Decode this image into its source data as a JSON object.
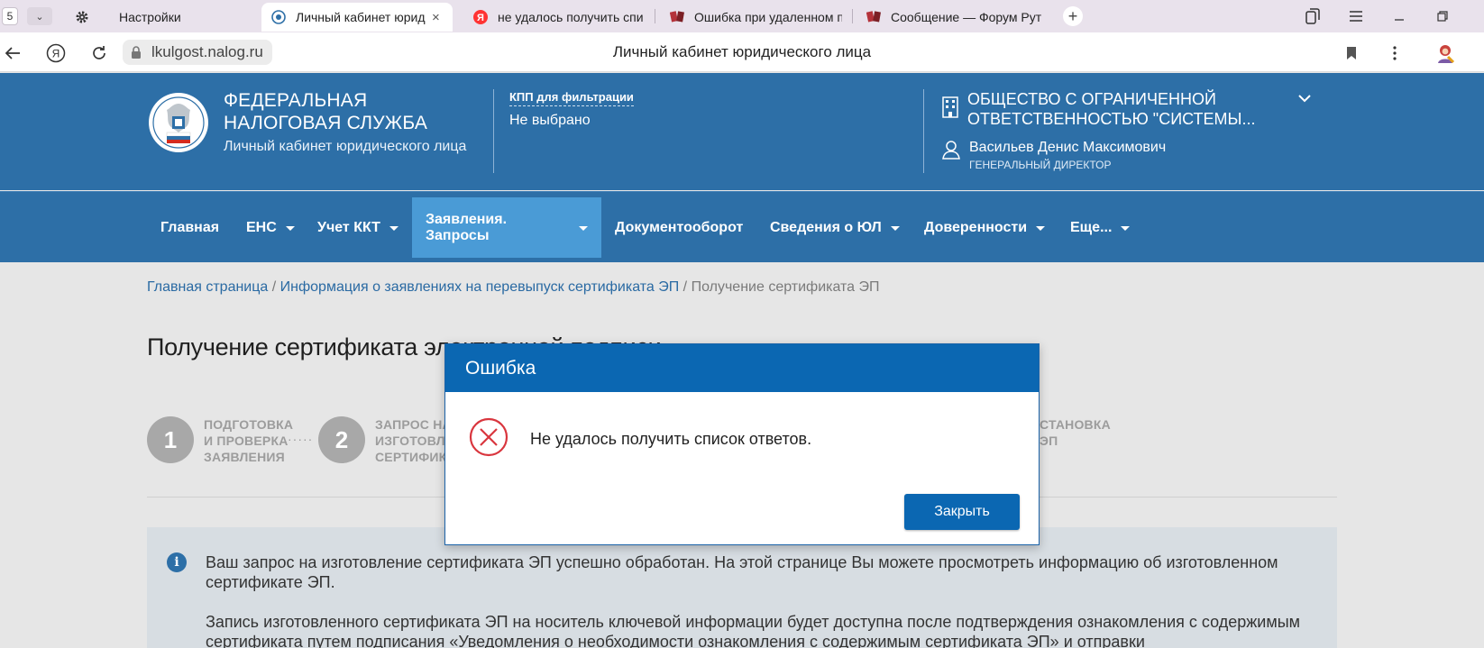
{
  "browser": {
    "tab_count": "5",
    "tabs": [
      {
        "label": "Настройки"
      },
      {
        "label": "Личный кабинет юрид"
      },
      {
        "label": "не удалось получить спис"
      },
      {
        "label": "Ошибка при удаленном п"
      },
      {
        "label": "Сообщение — Форум Рут"
      }
    ],
    "close_glyph": "×",
    "url": "lkulgost.nalog.ru",
    "page_title": "Личный кабинет юридического лица"
  },
  "header": {
    "title_line1": "ФЕДЕРАЛЬНАЯ",
    "title_line2": "НАЛОГОВАЯ СЛУЖБА",
    "subtitle": "Личный кабинет юридического лица",
    "kpp_label": "КПП для фильтрации",
    "kpp_value": "Не выбрано",
    "org_line1": "ОБЩЕСТВО С ОГРАНИЧЕННОЙ",
    "org_line2": "ОТВЕТСТВЕННОСТЬЮ \"СИСТЕМЫ...",
    "user_name": "Васильев Денис Максимович",
    "user_role": "ГЕНЕРАЛЬНЫЙ ДИРЕКТОР"
  },
  "nav": {
    "items": [
      {
        "label": "Главная"
      },
      {
        "label": "ЕНС"
      },
      {
        "label": "Учет ККТ"
      },
      {
        "label": "Заявления. Запросы"
      },
      {
        "label": "Документооборот"
      },
      {
        "label": "Сведения о ЮЛ"
      },
      {
        "label": "Доверенности"
      },
      {
        "label": "Еще..."
      }
    ]
  },
  "breadcrumb": {
    "home": "Главная страница",
    "sep1": " / ",
    "info": "Информация о заявлениях на перевыпуск сертификата ЭП",
    "sep2": " / ",
    "current": "Получение сертификата ЭП"
  },
  "page": {
    "title": "Получение сертификата электронной подписи"
  },
  "steps": [
    {
      "num": "1",
      "line1": "ПОДГОТОВКА",
      "line2": "И ПРОВЕРКА",
      "line3": "ЗАЯВЛЕНИЯ"
    },
    {
      "num": "2",
      "line1": "ЗАПРОС НА",
      "line2": "ИЗГОТОВЛЕНИЕ",
      "line3": "СЕРТИФИКАТА"
    },
    {
      "line1": "СТАНОВКА",
      "line2": "ЭП"
    }
  ],
  "step_dots": "·····",
  "info": {
    "p1": "Ваш запрос на изготовление сертификата ЭП успешно обработан. На этой странице Вы можете просмотреть информацию об изготовленном сертификате ЭП.",
    "p2": "Запись изготовленного сертификата ЭП на носитель ключевой информации будет доступна после подтверждения ознакомления с содержимым сертификата путем подписания «Уведомления о необходимости ознакомления с содержимым сертификата ЭП» и отправки"
  },
  "modal": {
    "title": "Ошибка",
    "message": "Не удалось получить список ответов.",
    "close_label": "Закрыть"
  },
  "colors": {
    "header_bg": "#2d6fa7",
    "nav_active": "#4a9bd6",
    "modal_head": "#0b67b2",
    "error_red": "#d9363e"
  }
}
